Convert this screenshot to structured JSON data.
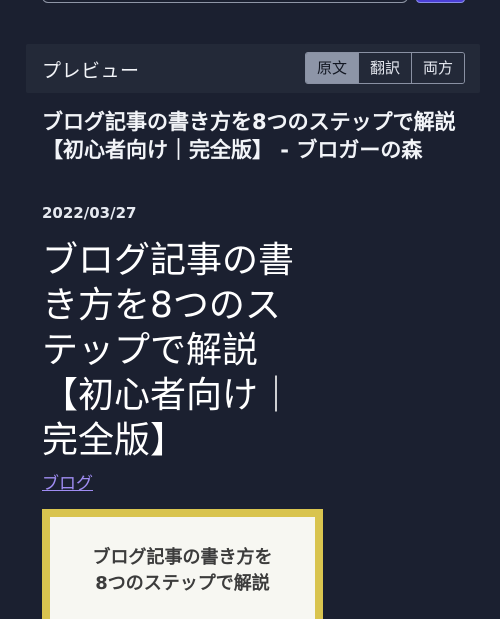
{
  "preview": {
    "title": "プレビュー",
    "tabs": [
      "原文",
      "翻訳",
      "両方"
    ],
    "active_tab": "原文"
  },
  "article": {
    "page_title": "ブログ記事の書き方を8つのステップで解説【初心者向け｜完全版】 - ブロガーの森",
    "date": "2022/03/27",
    "heading": "ブログ記事の書き方を8つのステップで解説【初心者向け｜完全版】",
    "category": "ブログ",
    "thumbnail_line1": "ブログ記事の書き方を",
    "thumbnail_line2": "8つのステップで解説"
  },
  "colors": {
    "background": "#1b2030",
    "panel": "#232938",
    "active_tab": "#8d95a7",
    "link": "#9f8cf2",
    "thumbnail_frame": "#d9c44f"
  }
}
